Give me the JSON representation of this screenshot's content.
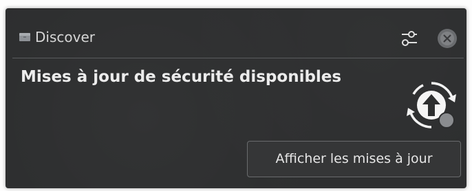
{
  "notification": {
    "app_name": "Discover",
    "app_icon": "discover-bag-icon",
    "summary": "Mises à jour de sécurité disponibles",
    "action_label": "Afficher les mises à jour",
    "header_icons": [
      "configure-icon",
      "close-icon"
    ],
    "status_icon": "system-update-icon"
  },
  "colors": {
    "background": "#2d2e2f",
    "text": "#ececec",
    "muted_text": "#d6d6d6",
    "border": "#6a6c6e"
  }
}
